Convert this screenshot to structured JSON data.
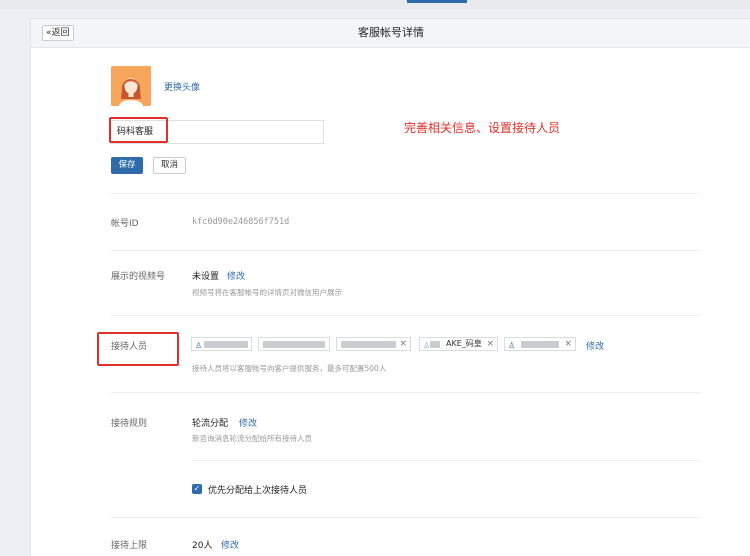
{
  "header": {
    "back_label": "«返回",
    "title": "客服帐号详情"
  },
  "profile": {
    "change_avatar_label": "更换头像",
    "name_value": "码科客服",
    "save_label": "保存",
    "cancel_label": "取消",
    "annotation": "完善相关信息、设置接待人员"
  },
  "account": {
    "id_label": "帐号ID",
    "id_value": "kfc0d90e246856f751d"
  },
  "video": {
    "label": "展示的视频号",
    "value": "未设置",
    "edit_label": "修改",
    "hint": "视频号将在客服帐号的详情页对微信用户展示"
  },
  "reception": {
    "label": "接待人员",
    "tags": [
      {
        "text": "",
        "removable": false
      },
      {
        "text": "",
        "removable": false
      },
      {
        "text": "",
        "removable": true
      },
      {
        "text": "AKE_码皇",
        "removable": true
      },
      {
        "text": "",
        "removable": true
      }
    ],
    "edit_label": "修改",
    "hint": "接待人员将以客服帐号向客户提供服务，最多可配置500人"
  },
  "rules": {
    "label": "接待规则",
    "value": "轮流分配",
    "edit_label": "修改",
    "hint": "新咨询消息轮流分配给所有接待人员",
    "checkbox_label": "优先分配给上次接待人员",
    "checkbox_checked": true
  },
  "limit": {
    "label": "接待上限",
    "value": "20人",
    "edit_label": "修改"
  },
  "colors": {
    "accent": "#2f6ba8",
    "annotation_red": "#e0302a"
  }
}
